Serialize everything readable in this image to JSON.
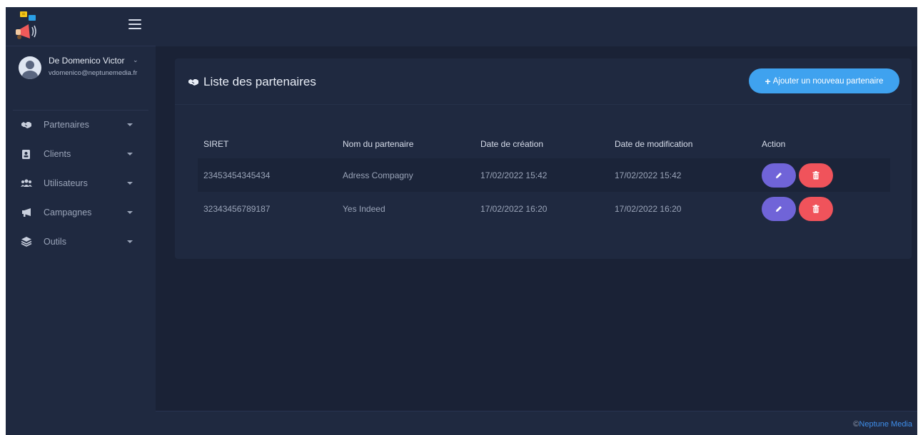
{
  "sidebar": {
    "user": {
      "name": "De Domenico Victor",
      "email": "vdomenico@neptunemedia.fr"
    },
    "items": [
      {
        "label": "Partenaires",
        "icon": "handshake-icon"
      },
      {
        "label": "Clients",
        "icon": "contact-card-icon"
      },
      {
        "label": "Utilisateurs",
        "icon": "users-icon"
      },
      {
        "label": "Campagnes",
        "icon": "megaphone-icon"
      },
      {
        "label": "Outils",
        "icon": "layers-icon"
      }
    ]
  },
  "card": {
    "title": "Liste des partenaires",
    "add_button": "Ajouter un nouveau partenaire"
  },
  "table": {
    "headers": [
      "SIRET",
      "Nom du partenaire",
      "Date de création",
      "Date de modification",
      "Action"
    ],
    "rows": [
      {
        "siret": "23453454345434",
        "name": "Adress Compagny",
        "created": "17/02/2022 15:42",
        "modified": "17/02/2022 15:42"
      },
      {
        "siret": "32343456789187",
        "name": "Yes Indeed",
        "created": "17/02/2022 16:20",
        "modified": "17/02/2022 16:20"
      }
    ]
  },
  "footer": {
    "copyright_symbol": "©",
    "company": "Neptune Media"
  },
  "colors": {
    "background": "#1a2236",
    "panel": "#1f2940",
    "accent_blue": "#3fa2ef",
    "edit_purple": "#7064d8",
    "delete_red": "#f0535b"
  }
}
